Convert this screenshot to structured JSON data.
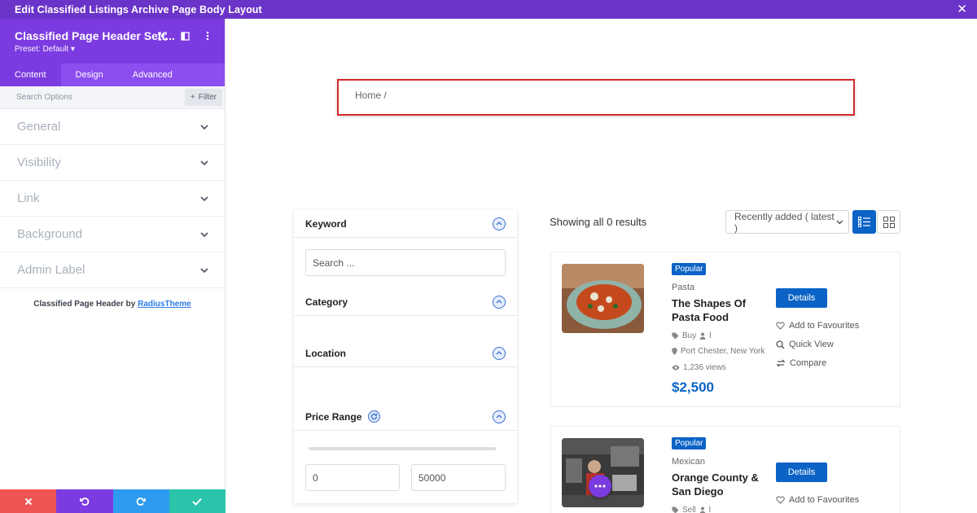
{
  "topbar": {
    "title": "Edit Classified Listings Archive Page Body Layout"
  },
  "panel": {
    "title": "Classified Page Header Sett...",
    "preset": "Preset: Default",
    "tabs": [
      {
        "label": "Content"
      },
      {
        "label": "Design"
      },
      {
        "label": "Advanced"
      }
    ],
    "search_placeholder": "Search Options",
    "filter_label": "Filter",
    "sections": [
      {
        "label": "General"
      },
      {
        "label": "Visibility"
      },
      {
        "label": "Link"
      },
      {
        "label": "Background"
      },
      {
        "label": "Admin Label"
      }
    ],
    "credit_prefix": "Classified Page Header by ",
    "credit_link": "RadiusTheme"
  },
  "breadcrumb": {
    "text": "Home /"
  },
  "filters": {
    "keyword_label": "Keyword",
    "search_placeholder": "Search ...",
    "category_label": "Category",
    "location_label": "Location",
    "price_label": "Price Range",
    "min_price": "0",
    "max_price": "50000"
  },
  "listing": {
    "results_text": "Showing all 0 results",
    "sort_value": "Recently added ( latest )"
  },
  "cards": [
    {
      "badge": "Popular",
      "category": "Pasta",
      "title": "The Shapes Of Pasta Food",
      "type": "Buy",
      "user": "l",
      "location": "Port Chester, New York",
      "views": "1,236 views",
      "price": "$2,500",
      "details": "Details",
      "favourite": "Add to Favourites",
      "quick_view": "Quick View",
      "compare": "Compare"
    },
    {
      "badge": "Popular",
      "category": "Mexican",
      "title": "Orange County & San Diego",
      "type": "Sell",
      "user": "l",
      "details": "Details",
      "favourite": "Add to Favourites"
    }
  ],
  "colors": {
    "brand_purple": "#7b3be0",
    "accent_blue": "#0b63c6",
    "highlight_red": "#d32a2a"
  }
}
